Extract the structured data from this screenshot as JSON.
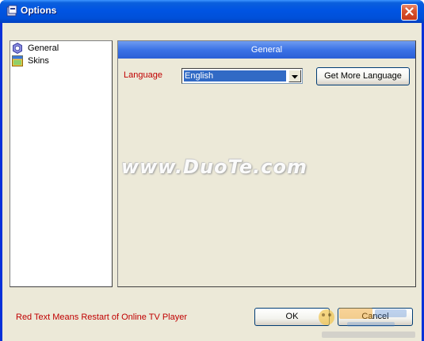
{
  "window": {
    "title": "Options",
    "title_icon": "options-app-icon",
    "close_icon": "close-icon"
  },
  "tree": {
    "items": [
      {
        "label": "General",
        "icon": "general-settings-icon"
      },
      {
        "label": "Skins",
        "icon": "skins-icon"
      }
    ]
  },
  "panel": {
    "header": "General",
    "language_label": "Language",
    "language_value": "English",
    "get_more_label": "Get More Language"
  },
  "watermark": "www.DuoTe.com",
  "footer": {
    "note": "Red Text Means Restart of Online TV Player",
    "ok_label": "OK",
    "cancel_label": "Cancel"
  },
  "colors": {
    "titlebar": "#0054e3",
    "panel_header": "#3b72e6",
    "restart_text": "#c00000",
    "selection": "#316ac5",
    "client_bg": "#ece9d8"
  }
}
